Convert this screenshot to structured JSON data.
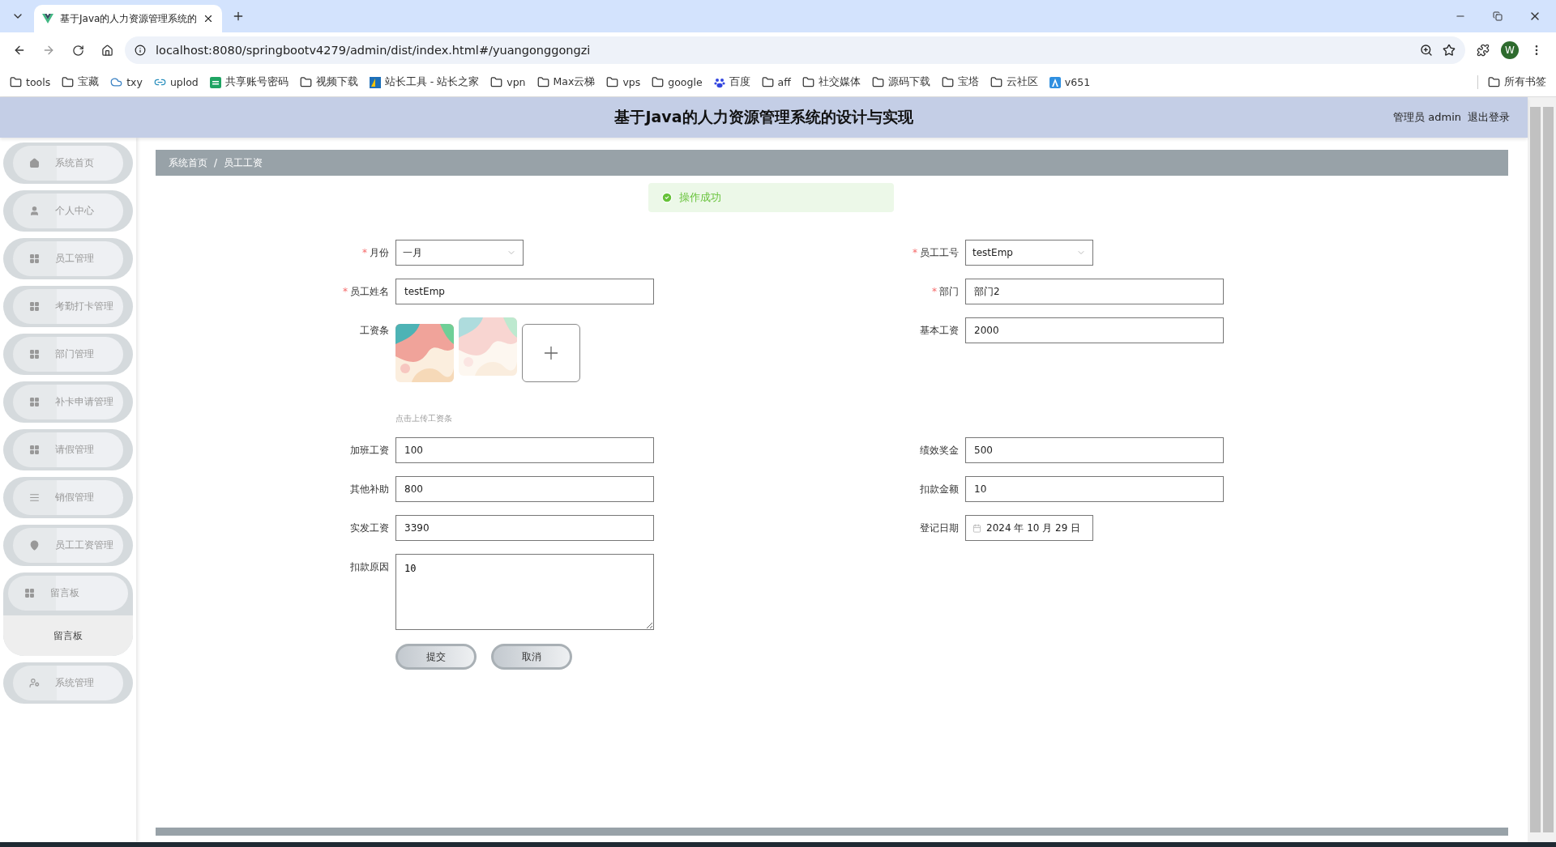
{
  "browser": {
    "tabs": [
      {
        "title": "基于Java的人力资源管理系统的",
        "selected": true
      }
    ],
    "url": "localhost:8080/springbootv4279/admin/dist/index.html#/yuangonggongzi",
    "profile": "W",
    "bookmarks": [
      {
        "label": "tools",
        "kind": "folder"
      },
      {
        "label": "宝藏",
        "kind": "folder"
      },
      {
        "label": "txy",
        "kind": "cloud"
      },
      {
        "label": "uplod",
        "kind": "link"
      },
      {
        "label": "共享账号密码",
        "kind": "sheet"
      },
      {
        "label": "视频下载",
        "kind": "folder"
      },
      {
        "label": "站长工具 - 站长之家",
        "kind": "site"
      },
      {
        "label": "vpn",
        "kind": "folder"
      },
      {
        "label": "Max云梯",
        "kind": "folder"
      },
      {
        "label": "vps",
        "kind": "folder"
      },
      {
        "label": "google",
        "kind": "folder"
      },
      {
        "label": "百度",
        "kind": "paw"
      },
      {
        "label": "aff",
        "kind": "folder"
      },
      {
        "label": "社交媒体",
        "kind": "folder"
      },
      {
        "label": "源码下载",
        "kind": "folder"
      },
      {
        "label": "宝塔",
        "kind": "folder"
      },
      {
        "label": "云社区",
        "kind": "folder"
      },
      {
        "label": "v651",
        "kind": "app"
      }
    ],
    "all_bookmarks": "所有书签"
  },
  "header": {
    "title": "基于Java的人力资源管理系统的设计与实现",
    "user": "管理员 admin",
    "logout": "退出登录"
  },
  "toast": {
    "message": "操作成功"
  },
  "sidebar": {
    "items": [
      {
        "label": "系统首页",
        "expanded": false
      },
      {
        "label": "个人中心",
        "expanded": false
      },
      {
        "label": "员工管理",
        "expanded": false
      },
      {
        "label": "考勤打卡管理",
        "expanded": false
      },
      {
        "label": "部门管理",
        "expanded": false
      },
      {
        "label": "补卡申请管理",
        "expanded": false
      },
      {
        "label": "请假管理",
        "expanded": false
      },
      {
        "label": "销假管理",
        "expanded": false
      },
      {
        "label": "员工工资管理",
        "expanded": false
      },
      {
        "label": "留言板",
        "expanded": true,
        "children": [
          {
            "label": "留言板"
          }
        ]
      },
      {
        "label": "系统管理",
        "expanded": false
      }
    ]
  },
  "breadcrumb": {
    "items": [
      "系统首页",
      "员工工资"
    ],
    "separator": "/"
  },
  "form": {
    "required_mark": "*",
    "rows": [
      [
        {
          "label": "月份",
          "kind": "select",
          "value": "一月",
          "required": true
        },
        {
          "label": "员工工号",
          "kind": "select",
          "value": "testEmp",
          "required": true
        }
      ],
      [
        {
          "label": "员工姓名",
          "kind": "input",
          "value": "testEmp",
          "required": true
        },
        {
          "label": "部门",
          "kind": "input",
          "value": "部门2",
          "required": true
        }
      ],
      [
        {
          "label": "工资条",
          "kind": "upload",
          "required": false,
          "images": [
            {
              "kind": "picture",
              "faded": false
            },
            {
              "kind": "picture",
              "faded": true
            }
          ],
          "hint": "点击上传工资条"
        },
        {
          "label": "基本工资",
          "kind": "input",
          "value": "2000",
          "required": false
        }
      ],
      [
        {
          "label": "加班工资",
          "kind": "input",
          "value": "100",
          "required": false
        },
        {
          "label": "绩效奖金",
          "kind": "input",
          "value": "500",
          "required": false
        }
      ],
      [
        {
          "label": "其他补助",
          "kind": "input",
          "value": "800",
          "required": false
        },
        {
          "label": "扣款金额",
          "kind": "input",
          "value": "10",
          "required": false
        }
      ],
      [
        {
          "label": "实发工资",
          "kind": "input",
          "value": "3390",
          "required": false
        },
        {
          "label": "登记日期",
          "kind": "date",
          "value": "2024 年 10 月 29 日",
          "required": false
        }
      ],
      [
        {
          "label": "扣款原因",
          "kind": "textarea",
          "value": "10",
          "required": false
        }
      ]
    ],
    "buttons": [
      "提交",
      "取消"
    ]
  }
}
